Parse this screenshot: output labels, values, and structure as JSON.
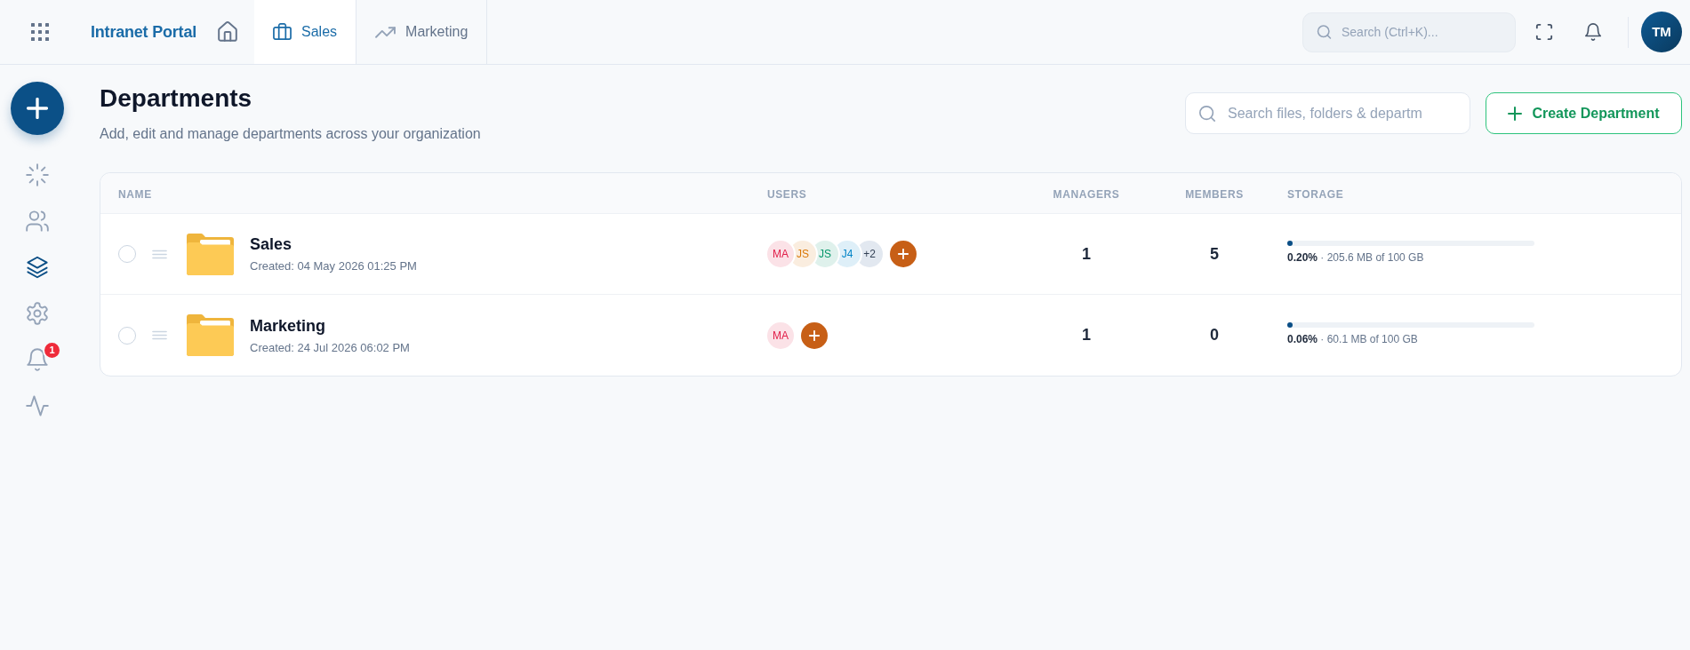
{
  "topbar": {
    "brand": "Intranet Portal",
    "tabs": [
      {
        "label": "Sales",
        "selected": true
      },
      {
        "label": "Marketing",
        "selected": false
      }
    ],
    "search": {
      "placeholder": "Search (Ctrl+K)..."
    },
    "avatar": "TM"
  },
  "sidebar": {
    "items": [
      {
        "selected": false
      },
      {
        "selected": false
      },
      {
        "selected": true
      },
      {
        "selected": false
      },
      {
        "selected": false,
        "badge": "1"
      },
      {
        "selected": false
      }
    ]
  },
  "page": {
    "title": "Departments",
    "subtitle": "Add, edit and manage departments across your organization",
    "search": {
      "placeholder": "Search files, folders & departm"
    },
    "create_button": "Create Department"
  },
  "table": {
    "columns": [
      "NAME",
      "USERS",
      "MANAGERS",
      "MEMBERS",
      "STORAGE"
    ],
    "rows": [
      {
        "selected": false,
        "name": "Sales",
        "created": "Created: 04 May 2026 01:25 PM",
        "users": [
          {
            "initials": "MA",
            "color": "#e11d48"
          },
          {
            "initials": "JS",
            "color": "#d97706"
          },
          {
            "initials": "JS",
            "color": "#059669"
          },
          {
            "initials": "J4",
            "color": "#0284c7"
          }
        ],
        "more_users": "+2",
        "managers": "1",
        "members": "5",
        "storage": {
          "level": 0.002,
          "usage": "**0.20%** · 205.6 MB of 100 GB"
        }
      },
      {
        "selected": false,
        "name": "Marketing",
        "created": "Created: 24 Jul 2026 06:02 PM",
        "users": [
          {
            "initials": "MA",
            "color": "#e11d48"
          }
        ],
        "managers": "1",
        "members": "0",
        "storage": {
          "level": 0.0006,
          "usage": "**0.06%** · 60.1 MB of 100 GB"
        }
      }
    ]
  }
}
